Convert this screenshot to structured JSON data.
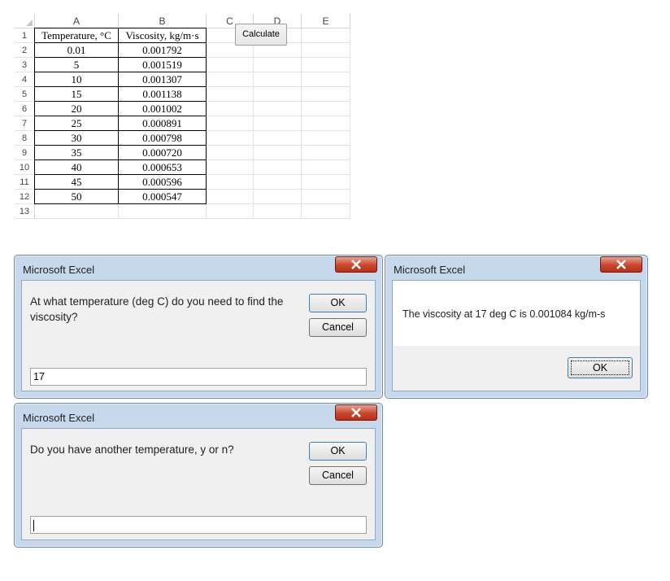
{
  "sheet": {
    "columns": [
      "A",
      "B",
      "C",
      "D",
      "E"
    ],
    "rows": [
      "1",
      "2",
      "3",
      "4",
      "5",
      "6",
      "7",
      "8",
      "9",
      "10",
      "11",
      "12",
      "13"
    ],
    "headers": {
      "temperature": "Temperature, °C",
      "viscosity": "Viscosity, kg/m·s"
    },
    "temperatures": [
      "0.01",
      "5",
      "10",
      "15",
      "20",
      "25",
      "30",
      "35",
      "40",
      "45",
      "50"
    ],
    "viscosities": [
      "0.001792",
      "0.001519",
      "0.001307",
      "0.001138",
      "0.001002",
      "0.000891",
      "0.000798",
      "0.000720",
      "0.000653",
      "0.000596",
      "0.000547"
    ],
    "calculate_label": "Calculate"
  },
  "dialog_temp": {
    "title": "Microsoft Excel",
    "prompt": "At what temperature (deg C) do you need to find the viscosity?",
    "ok_label": "OK",
    "cancel_label": "Cancel",
    "input_value": "17"
  },
  "dialog_result": {
    "title": "Microsoft Excel",
    "message": "The viscosity at 17 deg C is 0.001084 kg/m-s",
    "ok_label": "OK"
  },
  "dialog_again": {
    "title": "Microsoft Excel",
    "prompt": "Do you have another temperature, y or n?",
    "ok_label": "OK",
    "cancel_label": "Cancel",
    "input_value": ""
  },
  "icons": {
    "close": "close-icon",
    "select_all": "select-all-triangle-icon"
  },
  "colors": {
    "titlebar": "#c6d9ec",
    "close_button": "#c9462b",
    "dialog_body": "#f0f0f0"
  }
}
